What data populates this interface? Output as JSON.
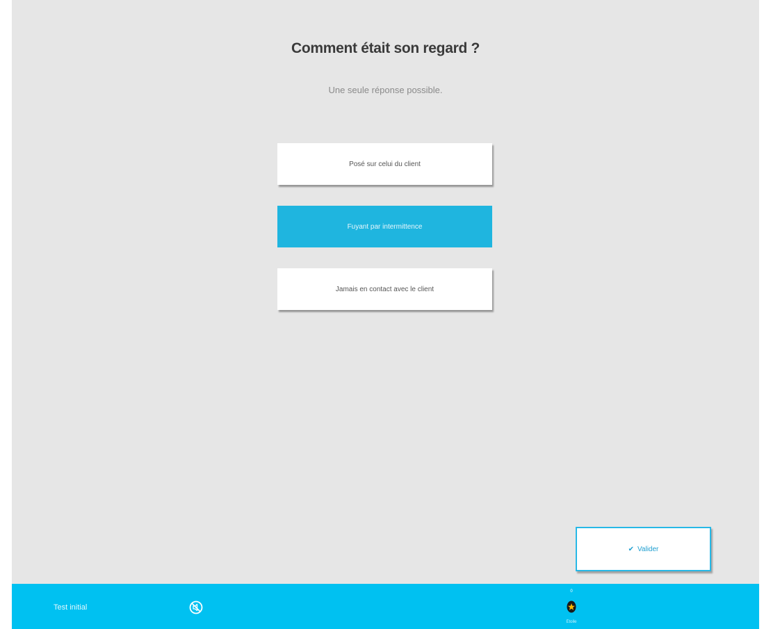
{
  "question": {
    "title": "Comment était son regard ?",
    "subtitle": "Une seule réponse possible."
  },
  "answers": [
    {
      "label": "Posé sur celui du client",
      "selected": false
    },
    {
      "label": "Fuyant par intermittence",
      "selected": true
    },
    {
      "label": "Jamais en contact avec le client",
      "selected": false
    }
  ],
  "validate_button": {
    "label": "Valider",
    "icon": "checkmark-icon"
  },
  "bottom_bar": {
    "title": "Test initial",
    "sound_icon": "no-sound-icon",
    "stars": {
      "count": "0",
      "icon": "star-icon",
      "label": "Étoile"
    }
  },
  "colors": {
    "background": "#e6e6e6",
    "accent": "#1fb5df",
    "bar": "#00c1f1",
    "star": "#f5b800"
  }
}
